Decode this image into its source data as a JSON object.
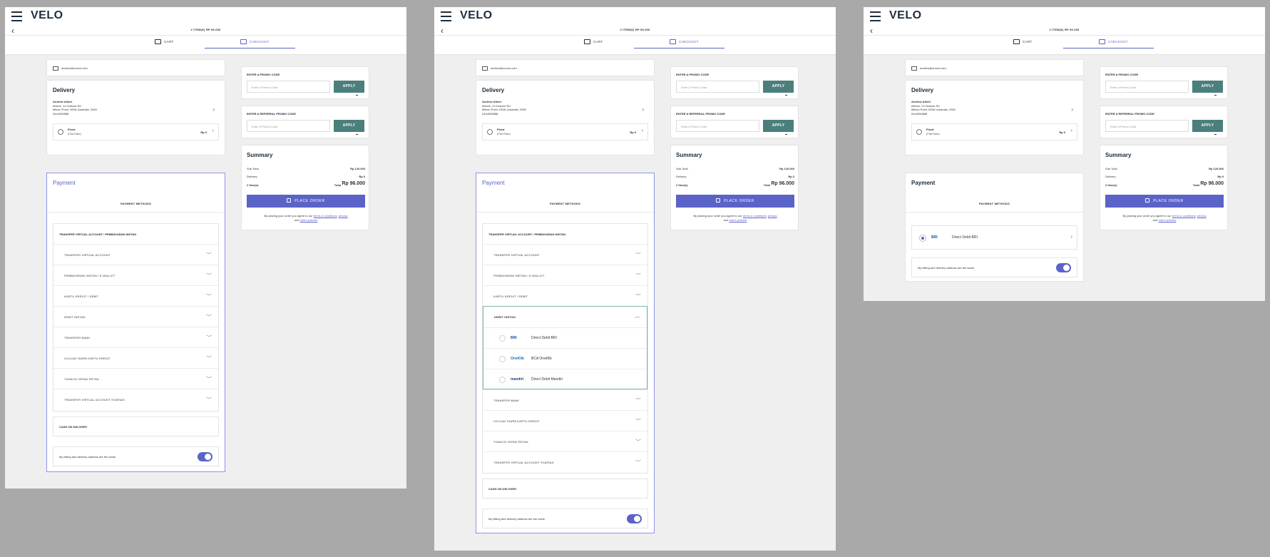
{
  "brand": {
    "logo": "VELO"
  },
  "header": {
    "items_summary": "2 ITEM(S) RP 96.000",
    "tab_cart": "CART",
    "tab_checkout": "CHECKOUT"
  },
  "email": "andrew@ounce.com",
  "delivery": {
    "title": "Delivery",
    "name": "Andrew Albert",
    "line1": "eMove, 24 Holsom Rd",
    "line2": "Milson Point, NSW, Australia, 2060",
    "phone": "0444999888",
    "shipping_name": "Fixed",
    "shipping_sub": "(Flat Rate)",
    "shipping_price": "Rp 0"
  },
  "payment": {
    "title": "Payment",
    "methods_label": "PAYMENT METHODS",
    "group_title": "TRANSFER VIRTUAL ACCOUNT / PEMBAYARAN INSTAN",
    "options": [
      "TRANSFER VIRTUAL ACCOUNT",
      "PEMBAYARAN INSTAN / E-WALLET",
      "KARTU KREDIT / DEBIT",
      "DEBIT INSTAN",
      "TRANSFER BANK",
      "CICILAN TANPA KARTU KREDIT",
      "TUNAI DI GERAI RETAIL",
      "TRANSFER VIRTUAL ACCOUNT SYARIAH"
    ],
    "debit_banks": [
      {
        "logo": "BRI",
        "name": "Direct Debit BRI",
        "color": "#1d4fa3"
      },
      {
        "logo": "OneKlik",
        "name": "BCA OneKlik",
        "color": "#1d6fb8"
      },
      {
        "logo": "mandiri",
        "name": "Direct Debit Mandiri",
        "color": "#1d3f7a"
      }
    ],
    "cod_label": "CASH ON DELIVERY",
    "billing_label": "My billing and delivery address are the same",
    "selected_bank": "Direct Debit BRI"
  },
  "promo": {
    "title": "ENTER A PROMO CODE",
    "referral_title": "ENTER A REFERRAL PROMO CODE",
    "placeholder": "Enter A Promo Code",
    "apply": "APPLY"
  },
  "summary": {
    "title": "Summary",
    "subtotal_label": "Sub Total",
    "subtotal": "Rp 120.000",
    "delivery_label": "Delivery",
    "delivery": "Rp 0",
    "items_label": "2 Item(s)",
    "total_label": "Total",
    "total": "Rp 96.000",
    "place_order": "PLACE ORDER",
    "terms_prefix": "By placing your order you agree to our",
    "terms_link": "terms & conditions",
    "privacy_link": "privacy",
    "and": "and",
    "return_link": "return policies"
  },
  "colors": {
    "accent": "#5a63c7",
    "apply": "#4b7f7c",
    "page": "#efefef"
  }
}
